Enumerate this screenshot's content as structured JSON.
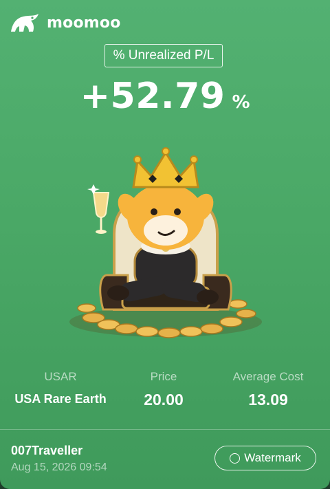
{
  "brand": {
    "name": "moomoo",
    "icon": "bull-logo-icon"
  },
  "metric": {
    "label": "% Unrealized P/L",
    "value": "+52.79",
    "unit": "%"
  },
  "illustration": {
    "icon": "mascot-king-on-throne-with-coins"
  },
  "stock": {
    "ticker": "USAR",
    "name": "USA Rare Earth",
    "price_label": "Price",
    "price": "20.00",
    "avg_cost_label": "Average Cost",
    "avg_cost": "13.09"
  },
  "footer": {
    "username": "007Traveller",
    "timestamp": "Aug 15, 2026 09:54",
    "watermark_label": "Watermark",
    "watermark_icon": "radio-circle-icon"
  },
  "colors": {
    "background": "#4aa866",
    "text": "#ffffff",
    "muted_text": "#a8d6b7",
    "crown": "#f2c233",
    "mascot": "#f7b43c",
    "coin": "#e6b24a"
  }
}
